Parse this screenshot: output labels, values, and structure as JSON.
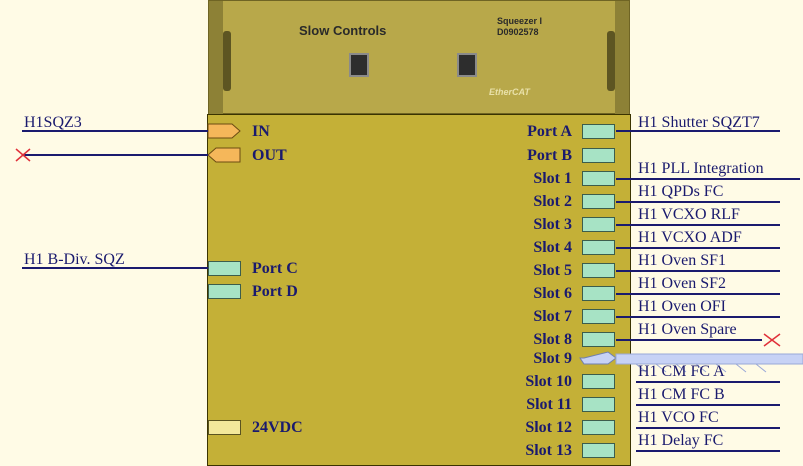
{
  "chassis": {
    "title": "Slow Controls",
    "module_name": "Squeezer I",
    "module_id": "D0902578",
    "bus_label": "EtherCAT"
  },
  "left_pins": [
    {
      "label": "IN",
      "signal": "H1SQZ3",
      "kind": "arrow"
    },
    {
      "label": "OUT",
      "signal": "",
      "kind": "arrow-out"
    },
    {
      "label": "Port C",
      "signal": "H1 B-Div. SQZ",
      "kind": "port"
    },
    {
      "label": "Port D",
      "signal": "",
      "kind": "port"
    },
    {
      "label": "24VDC",
      "signal": "",
      "kind": "power"
    }
  ],
  "right_pins": [
    {
      "label": "Port A",
      "signal": "H1 Shutter SQZT7"
    },
    {
      "label": "Port B",
      "signal": ""
    },
    {
      "label": "Slot 1",
      "signal": "H1 PLL Integration"
    },
    {
      "label": "Slot 2",
      "signal": "H1 QPDs FC"
    },
    {
      "label": "Slot 3",
      "signal": "H1 VCXO RLF"
    },
    {
      "label": "Slot 4",
      "signal": "H1 VCXO ADF"
    },
    {
      "label": "Slot 5",
      "signal": "H1 Oven SF1"
    },
    {
      "label": "Slot 6",
      "signal": "H1 Oven SF2"
    },
    {
      "label": "Slot 7",
      "signal": "H1 Oven OFI"
    },
    {
      "label": "Slot 8",
      "signal": "H1 Oven Spare"
    },
    {
      "label": "Slot 9",
      "signal": "H1 CM FC A"
    },
    {
      "label": "Slot 10",
      "signal": "H1 CM FC B"
    },
    {
      "label": "Slot 11",
      "signal": "H1 VCO FC"
    },
    {
      "label": "Slot 12",
      "signal": "H1 Delay FC"
    },
    {
      "label": "Slot 13",
      "signal": ""
    }
  ],
  "colors": {
    "wire": "#1a1a6e",
    "box_body": "#c4b037",
    "port_fill": "#a7e3c5",
    "arrow_fill": "#f5b75a",
    "no_connect": "#e0303a",
    "bus": "#c7d2f5"
  }
}
